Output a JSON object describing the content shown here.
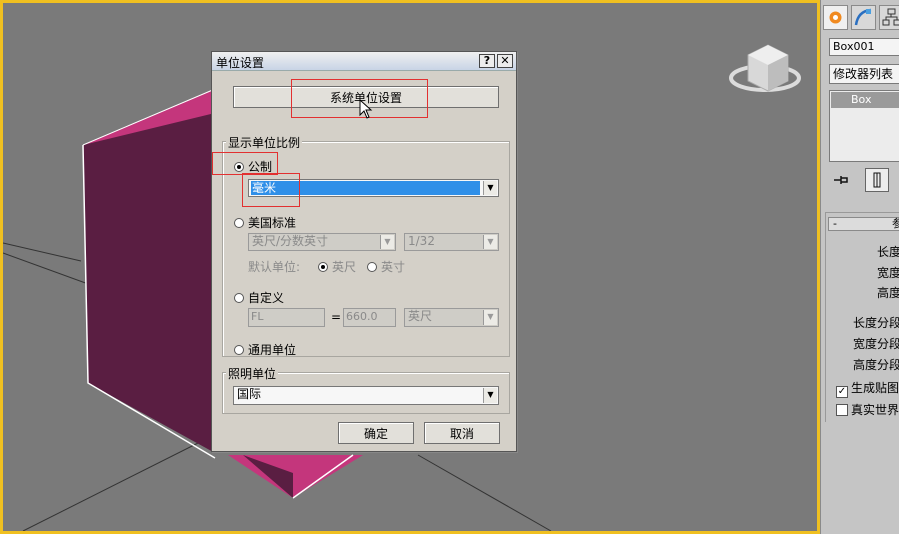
{
  "dialog": {
    "title": "单位设置",
    "help_btn": "?",
    "close_btn": "✕",
    "system_units_btn": "系统单位设置",
    "display_scale": {
      "legend": "显示单位比例",
      "metric_label": "公制",
      "metric_value": "毫米",
      "us_label": "美国标准",
      "us_units": "英尺/分数英寸",
      "us_fraction": "1/32",
      "default_unit_label": "默认单位:",
      "default_feet": "英尺",
      "default_inch": "英寸",
      "custom_label": "自定义",
      "custom_name": "FL",
      "custom_equals": "=",
      "custom_value": "660.0",
      "custom_unit": "英尺",
      "generic_label": "通用单位"
    },
    "lighting": {
      "legend": "照明单位",
      "value": "国际"
    },
    "ok_btn": "确定",
    "cancel_btn": "取消"
  },
  "command_panel": {
    "object_name": "Box001",
    "modifier_list": "修改器列表",
    "stack_item": "Box",
    "rollout_title": "参",
    "rollout_toggle": "-",
    "param_length": "长度",
    "param_width": "宽度",
    "param_height": "高度",
    "param_length_segs": "长度分段",
    "param_width_segs": "宽度分段",
    "param_height_segs": "高度分段",
    "gen_mapping": "生成贴图",
    "real_world": "真实世界"
  },
  "colors": {
    "viewport_bg": "#7a7a7a",
    "viewport_border": "#f0c020",
    "box_front": "#5a1e42",
    "box_top": "#c4367c",
    "highlight": "#e23030",
    "selection": "#2f8fe8"
  }
}
